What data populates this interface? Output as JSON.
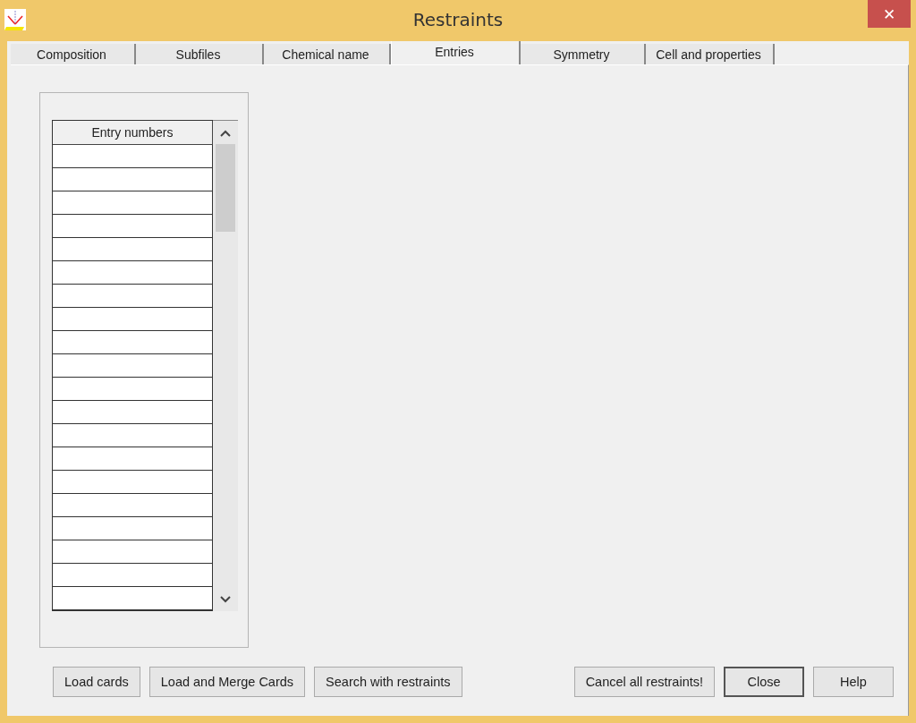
{
  "window": {
    "title": "Restraints",
    "close": "✕"
  },
  "tabs": [
    {
      "label": "Composition",
      "selected": false
    },
    {
      "label": "Subfiles",
      "selected": false
    },
    {
      "label": "Chemical name",
      "selected": false
    },
    {
      "label": "Entries",
      "selected": true
    },
    {
      "label": "Symmetry",
      "selected": false
    },
    {
      "label": "Cell and properties",
      "selected": false
    }
  ],
  "table": {
    "columns": [
      "Entry numbers"
    ]
  },
  "buttons_left": [
    {
      "label": "Load cards",
      "default": false
    },
    {
      "label": "Load and Merge Cards",
      "default": false
    },
    {
      "label": "Search with restraints",
      "default": false
    }
  ],
  "buttons_right": [
    {
      "label": "Cancel all restraints!",
      "default": false
    },
    {
      "label": "Close",
      "default": true
    },
    {
      "label": "Help",
      "default": false
    }
  ]
}
